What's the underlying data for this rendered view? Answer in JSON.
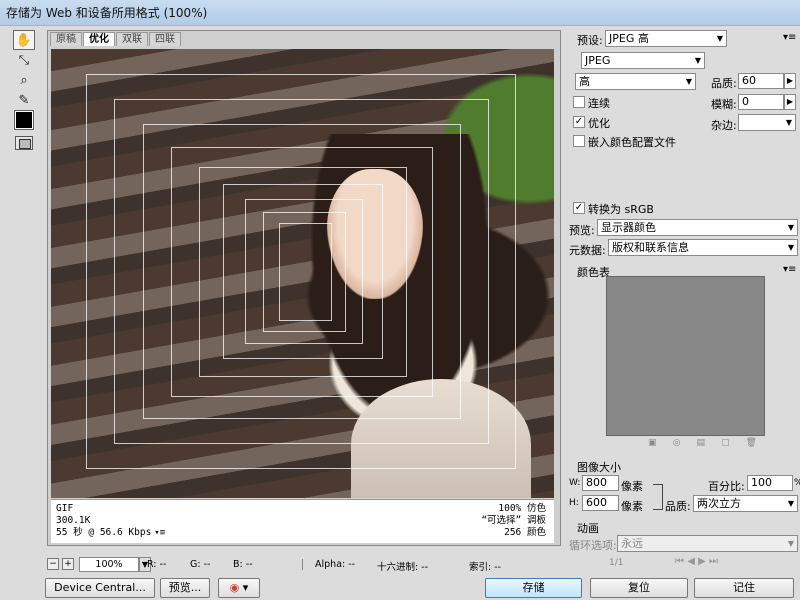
{
  "window": {
    "title": "存储为 Web 和设备所用格式 (100%)"
  },
  "tools": [
    {
      "name": "hand-tool-icon",
      "glyph": "✋"
    },
    {
      "name": "slice-select-tool-icon",
      "glyph": "⤡"
    },
    {
      "name": "zoom-tool-icon",
      "glyph": "🔍"
    },
    {
      "name": "eyedropper-tool-icon",
      "glyph": "✎"
    }
  ],
  "tabs": [
    "原稿",
    "优化",
    "双联",
    "四联"
  ],
  "canvas_info": {
    "format": "GIF",
    "size": "300.1K",
    "time": "55 秒 @ 56.6 Kbps",
    "dither": "100% 仿色",
    "palette": "“可选择” 调板",
    "colors": "256 颜色"
  },
  "status": {
    "zoom": "100%",
    "r": "R: --",
    "g": "G: --",
    "b": "B: --",
    "alpha": "Alpha: --",
    "hex": "十六进制: --",
    "index": "索引: --"
  },
  "buttons": {
    "device_central": "Device Central...",
    "preview": "预览...",
    "save": "存储",
    "reset": "复位",
    "remember": "记住"
  },
  "panel": {
    "preset_label": "预设:",
    "preset_value": "JPEG 高",
    "format_value": "JPEG",
    "quality_preset": "高",
    "quality_label": "品质:",
    "quality_value": "60",
    "progressive": "连续",
    "blur_label": "模糊:",
    "blur_value": "0",
    "optimized": "优化",
    "matte_label": "杂边:",
    "embed_profile": "嵌入颜色配置文件",
    "convert_srgb": "转换为 sRGB",
    "preview_label": "预览:",
    "preview_value": "显示器颜色",
    "metadata_label": "元数据:",
    "metadata_value": "版权和联系信息",
    "color_table_title": "颜色表",
    "image_size_title": "图像大小",
    "w_label": "W:",
    "w_value": "800",
    "h_label": "H:",
    "h_value": "600",
    "px_unit": "像素",
    "percent_label": "百分比:",
    "percent_value": "100",
    "percent_unit": "%",
    "resample_label": "品质:",
    "resample_value": "两次立方",
    "animation_title": "动画",
    "loop_label": "循环选项:",
    "loop_value": "永远",
    "frame_counter": "1/1"
  },
  "colors": {
    "accent": "#3c7fb1",
    "color_table_bg": "#888888",
    "panel_bg": "#dcdcdc"
  }
}
